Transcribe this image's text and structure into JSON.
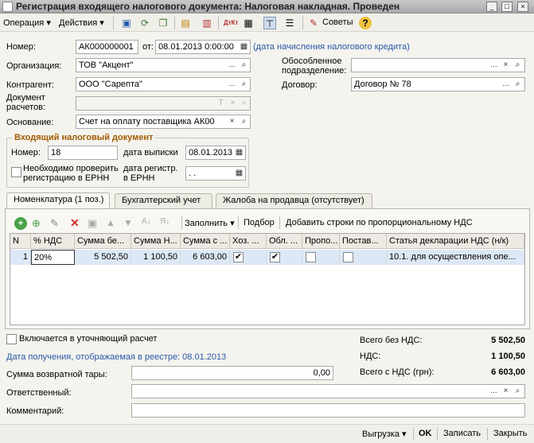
{
  "window": {
    "title": "Регистрация входящего налогового документа: Налоговая накладная. Проведен"
  },
  "toolbar": {
    "operation_label": "Операция",
    "actions_label": "Действия",
    "tips_label": "Советы"
  },
  "form": {
    "number_label": "Номер:",
    "number_value": "АК000000001",
    "from_label": "от:",
    "date_value": "08.01.2013  0:00:00",
    "date_note": "(дата начисления налогового кредита)",
    "org_label": "Организация:",
    "org_value": "ТОВ \"Акцент\"",
    "contractor_label": "Контрагент:",
    "contractor_value": "ООО \"Сарепта\"",
    "settlement_doc_label_1": "Документ",
    "settlement_doc_label_2": "расчетов:",
    "settlement_doc_value": "",
    "basis_label": "Основание:",
    "basis_value": "Счет на оплату поставщика АК00",
    "division_label_1": "Обособленное",
    "division_label_2": "подразделение:",
    "division_value": "",
    "contract_label": "Договор:",
    "contract_value": "Договор № 78"
  },
  "incoming": {
    "group_title": "Входящий налоговый документ",
    "number_label": "Номер:",
    "number_value": "18",
    "issue_date_label": "дата выписки",
    "issue_date_value": "08.01.2013",
    "need_check_label_1": "Необходимо проверить",
    "need_check_label_2": "регистрацию в ЕРНН",
    "need_check_checked": false,
    "reg_date_label_1": "дата регистр.",
    "reg_date_label_2": "в ЕРНН",
    "reg_date_value": " .  ."
  },
  "tabs": [
    {
      "label": "Номенклатура (1 поз.)",
      "active": true
    },
    {
      "label": "Бухгалтерский учет",
      "active": false
    },
    {
      "label": "Жалоба на продавца (отсутствует)",
      "active": false
    }
  ],
  "table_toolbar": {
    "fill_label": "Заполнить",
    "select_label": "Подбор",
    "add_prop_label": "Добавить строки по пропорциональному НДС"
  },
  "table": {
    "columns": [
      "N",
      "% НДС",
      "Сумма бе...",
      "Сумма Н...",
      "Сумма с ...",
      "Хоз. ...",
      "Обл. ...",
      "Пропо...",
      "Постав...",
      "Статья декларации НДС (н/к)"
    ],
    "rows": [
      {
        "n": "1",
        "vat_rate": "20%",
        "sum_without_vat": "5 502,50",
        "vat_sum": "1 100,50",
        "sum_with_vat": "6 603,00",
        "economic": true,
        "taxable": true,
        "proportional": false,
        "supply": false,
        "declaration_item": "10.1. для осуществления опе..."
      }
    ]
  },
  "bottom": {
    "refinement_label": "Включается в уточняющий расчет",
    "refinement_checked": false,
    "receipt_date_label": "Дата получения, отображаемая в реестре: 08.01.2013",
    "returnable_label": "Сумма возвратной тары:",
    "returnable_value": "0,00",
    "responsible_label": "Ответственный:",
    "responsible_value": "",
    "comment_label": "Комментарий:",
    "comment_value": "",
    "total_no_vat_label": "Всего без НДС:",
    "total_no_vat_value": "5 502,50",
    "vat_label": "НДС:",
    "vat_value": "1 100,50",
    "total_with_vat_label": "Всего с НДС (грн):",
    "total_with_vat_value": "6 603,00"
  },
  "footer": {
    "export_label": "Выгрузка",
    "ok_label": "OK",
    "save_label": "Записать",
    "close_label": "Закрыть"
  }
}
